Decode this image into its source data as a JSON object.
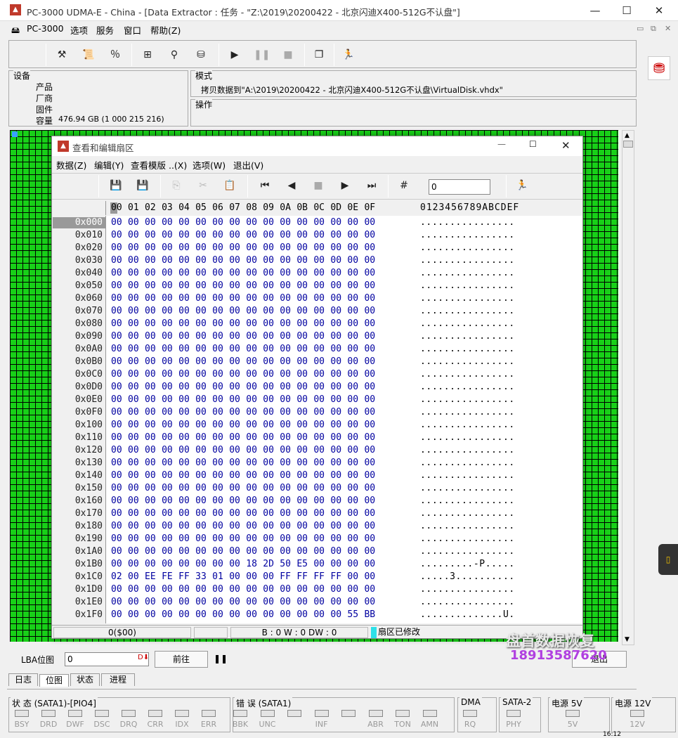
{
  "window": {
    "title": "PC-3000 UDMA-E - China - [Data Extractor : 任务 - \"Z:\\2019\\20200422 - 北京闪迪X400-512G不认盘\"]",
    "icon": "pc3000-logo-icon"
  },
  "menubar": [
    "PC-3000",
    "选项",
    "服务",
    "窗口",
    "帮助(Z)"
  ],
  "device": {
    "header": "设备",
    "product_label": "产品",
    "vendor_label": "厂商",
    "firmware_label": "固件",
    "capacity_label": "容量",
    "capacity_value": "476.94 GB (1 000 215 216)"
  },
  "mode": {
    "header": "模式",
    "text": "拷贝数据到\"A:\\2019\\20200422 - 北京闪迪X400-512G不认盘\\VirtualDisk.vhdx\""
  },
  "operation": {
    "header": "操作"
  },
  "dialog": {
    "title": "查看和编辑扇区",
    "menu": [
      "数据(Z)",
      "编辑(Y)",
      "查看模版 ..(X)",
      "选项(W)",
      "退出(V)"
    ],
    "jump_value": "0",
    "hex_header": [
      "00",
      "01",
      "02",
      "03",
      "04",
      "05",
      "06",
      "07",
      "08",
      "09",
      "0A",
      "0B",
      "0C",
      "0D",
      "0E",
      "0F"
    ],
    "ascii_header": "0123456789ABCDEF",
    "rows": [
      {
        "o": "0x000",
        "h": "00 00 00 00 00 00 00 00 00 00 00 00 00 00 00 00",
        "a": "................"
      },
      {
        "o": "0x010",
        "h": "00 00 00 00 00 00 00 00 00 00 00 00 00 00 00 00",
        "a": "................"
      },
      {
        "o": "0x020",
        "h": "00 00 00 00 00 00 00 00 00 00 00 00 00 00 00 00",
        "a": "................"
      },
      {
        "o": "0x030",
        "h": "00 00 00 00 00 00 00 00 00 00 00 00 00 00 00 00",
        "a": "................"
      },
      {
        "o": "0x040",
        "h": "00 00 00 00 00 00 00 00 00 00 00 00 00 00 00 00",
        "a": "................"
      },
      {
        "o": "0x050",
        "h": "00 00 00 00 00 00 00 00 00 00 00 00 00 00 00 00",
        "a": "................"
      },
      {
        "o": "0x060",
        "h": "00 00 00 00 00 00 00 00 00 00 00 00 00 00 00 00",
        "a": "................"
      },
      {
        "o": "0x070",
        "h": "00 00 00 00 00 00 00 00 00 00 00 00 00 00 00 00",
        "a": "................"
      },
      {
        "o": "0x080",
        "h": "00 00 00 00 00 00 00 00 00 00 00 00 00 00 00 00",
        "a": "................"
      },
      {
        "o": "0x090",
        "h": "00 00 00 00 00 00 00 00 00 00 00 00 00 00 00 00",
        "a": "................"
      },
      {
        "o": "0x0A0",
        "h": "00 00 00 00 00 00 00 00 00 00 00 00 00 00 00 00",
        "a": "................"
      },
      {
        "o": "0x0B0",
        "h": "00 00 00 00 00 00 00 00 00 00 00 00 00 00 00 00",
        "a": "................"
      },
      {
        "o": "0x0C0",
        "h": "00 00 00 00 00 00 00 00 00 00 00 00 00 00 00 00",
        "a": "................"
      },
      {
        "o": "0x0D0",
        "h": "00 00 00 00 00 00 00 00 00 00 00 00 00 00 00 00",
        "a": "................"
      },
      {
        "o": "0x0E0",
        "h": "00 00 00 00 00 00 00 00 00 00 00 00 00 00 00 00",
        "a": "................"
      },
      {
        "o": "0x0F0",
        "h": "00 00 00 00 00 00 00 00 00 00 00 00 00 00 00 00",
        "a": "................"
      },
      {
        "o": "0x100",
        "h": "00 00 00 00 00 00 00 00 00 00 00 00 00 00 00 00",
        "a": "................"
      },
      {
        "o": "0x110",
        "h": "00 00 00 00 00 00 00 00 00 00 00 00 00 00 00 00",
        "a": "................"
      },
      {
        "o": "0x120",
        "h": "00 00 00 00 00 00 00 00 00 00 00 00 00 00 00 00",
        "a": "................"
      },
      {
        "o": "0x130",
        "h": "00 00 00 00 00 00 00 00 00 00 00 00 00 00 00 00",
        "a": "................"
      },
      {
        "o": "0x140",
        "h": "00 00 00 00 00 00 00 00 00 00 00 00 00 00 00 00",
        "a": "................"
      },
      {
        "o": "0x150",
        "h": "00 00 00 00 00 00 00 00 00 00 00 00 00 00 00 00",
        "a": "................"
      },
      {
        "o": "0x160",
        "h": "00 00 00 00 00 00 00 00 00 00 00 00 00 00 00 00",
        "a": "................"
      },
      {
        "o": "0x170",
        "h": "00 00 00 00 00 00 00 00 00 00 00 00 00 00 00 00",
        "a": "................"
      },
      {
        "o": "0x180",
        "h": "00 00 00 00 00 00 00 00 00 00 00 00 00 00 00 00",
        "a": "................"
      },
      {
        "o": "0x190",
        "h": "00 00 00 00 00 00 00 00 00 00 00 00 00 00 00 00",
        "a": "................"
      },
      {
        "o": "0x1A0",
        "h": "00 00 00 00 00 00 00 00 00 00 00 00 00 00 00 00",
        "a": "................"
      },
      {
        "o": "0x1B0",
        "h": "00 00 00 00 00 00 00 00 18 2D 50 E5 00 00 00 00",
        "a": ".........-P....."
      },
      {
        "o": "0x1C0",
        "h": "02 00 EE FE FF 33 01 00 00 00 FF FF FF FF 00 00",
        "a": ".....3.........."
      },
      {
        "o": "0x1D0",
        "h": "00 00 00 00 00 00 00 00 00 00 00 00 00 00 00 00",
        "a": "................"
      },
      {
        "o": "0x1E0",
        "h": "00 00 00 00 00 00 00 00 00 00 00 00 00 00 00 00",
        "a": "................"
      },
      {
        "o": "0x1F0",
        "h": "00 00 00 00 00 00 00 00 00 00 00 00 00 00 55 BB",
        "a": "..............U."
      }
    ],
    "status": {
      "pos": "0($00)",
      "bw": "B : 0 W : 0 DW : 0",
      "modified": "扇区已修改"
    }
  },
  "lba": {
    "label": "LBA位图",
    "value": "0",
    "go": "前往",
    "exit": "退出"
  },
  "tabs": [
    "日志",
    "位图",
    "状态",
    "进程"
  ],
  "status_panels": {
    "state": {
      "title": "状 态 (SATA1)-[PIO4]",
      "leds": [
        "BSY",
        "DRD",
        "DWF",
        "DSC",
        "DRQ",
        "CRR",
        "IDX",
        "ERR"
      ]
    },
    "error": {
      "title": "错 误 (SATA1)",
      "leds": [
        "BBK",
        "UNC",
        "",
        "INF",
        "",
        "ABR",
        "TON",
        "AMN"
      ]
    },
    "dma": {
      "title": "DMA",
      "leds": [
        "RQ"
      ]
    },
    "sata2": {
      "title": "SATA-2",
      "leds": [
        "PHY"
      ]
    },
    "p5v": {
      "title": "电源 5V",
      "leds": [
        "5V"
      ]
    },
    "p12v": {
      "title": "电源 12V",
      "leds": [
        "12V"
      ]
    }
  },
  "watermark": {
    "line1": "盘首数据恢复",
    "line2": "18913587620"
  },
  "clock": "16:12"
}
